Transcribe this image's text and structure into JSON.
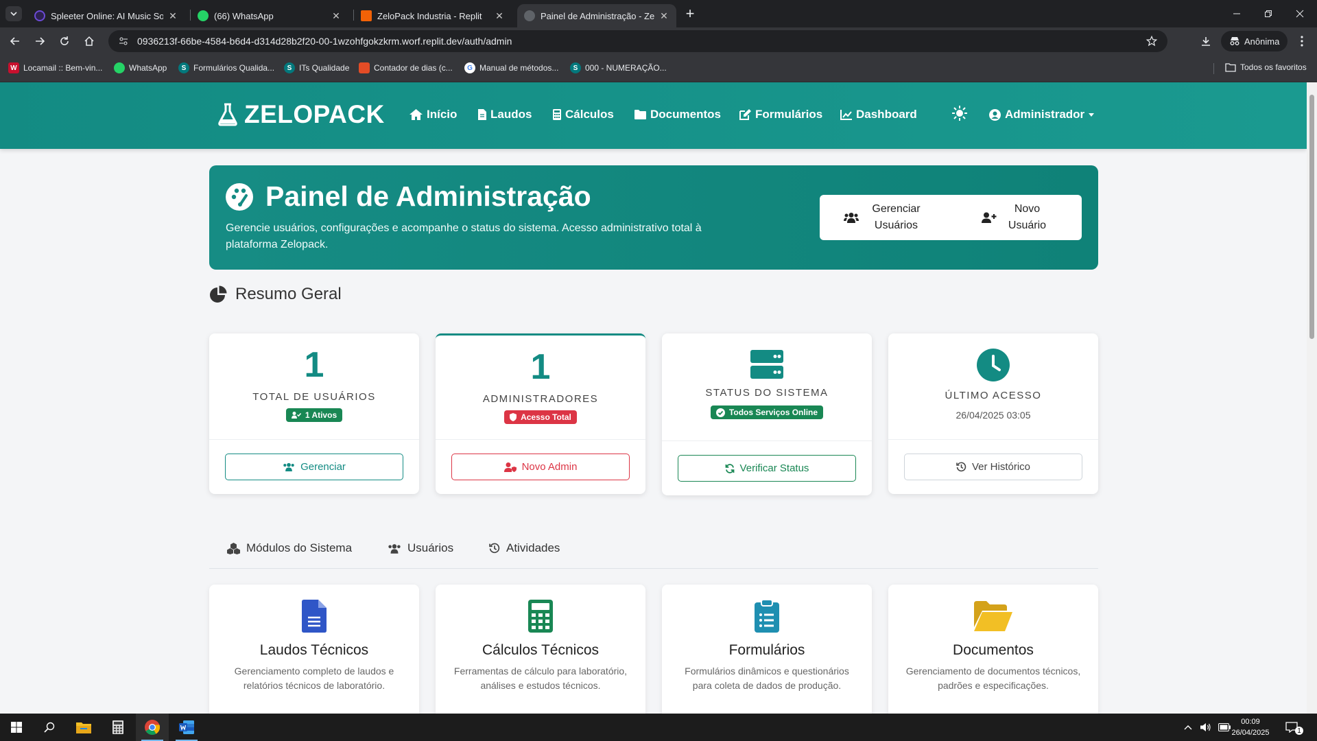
{
  "browser": {
    "tabs": [
      {
        "title": "Spleeter Online: AI Music Sourc",
        "active": false
      },
      {
        "title": "(66) WhatsApp",
        "active": false
      },
      {
        "title": "ZeloPack Industria - Replit",
        "active": false
      },
      {
        "title": "Painel de Administração - Zelop",
        "active": true
      }
    ],
    "url": "0936213f-66be-4584-b6d4-d314d28b2f20-00-1wzohfgokzkrm.worf.replit.dev/auth/admin",
    "incognito_label": "Anônima",
    "bookmarks": [
      {
        "label": "Locamail :: Bem-vin...",
        "icon": "locaweb-icon"
      },
      {
        "label": "WhatsApp",
        "icon": "whatsapp-icon"
      },
      {
        "label": "Formulários Qualida...",
        "icon": "sharepoint-icon"
      },
      {
        "label": "ITs Qualidade",
        "icon": "sharepoint-icon"
      },
      {
        "label": "Contador de dias (c...",
        "icon": "calendar-icon"
      },
      {
        "label": "Manual de métodos...",
        "icon": "google-icon"
      },
      {
        "label": "000 - NUMERAÇÃO...",
        "icon": "sharepoint-icon"
      }
    ],
    "all_bookmarks": "Todos os favoritos"
  },
  "nav": {
    "brand": "ZELOPACK",
    "links": [
      "Início",
      "Laudos",
      "Cálculos",
      "Documentos",
      "Formulários",
      "Dashboard"
    ],
    "user": "Administrador"
  },
  "hero": {
    "title": "Painel de Administração",
    "subtitle": "Gerencie usuários, configurações e acompanhe o status do sistema. Acesso administrativo total à plataforma Zelopack.",
    "btn_manage": "Gerenciar Usuários",
    "btn_new": "Novo Usuário"
  },
  "summary": {
    "title": "Resumo Geral",
    "cards": [
      {
        "value": "1",
        "label": "TOTAL DE USUÁRIOS",
        "badge": "1 Ativos",
        "button": "Gerenciar"
      },
      {
        "value": "1",
        "label": "ADMINISTRADORES",
        "badge": "Acesso Total",
        "button": "Novo Admin"
      },
      {
        "label": "STATUS DO SISTEMA",
        "badge": "Todos Serviços Online",
        "button": "Verificar Status"
      },
      {
        "label": "ÚLTIMO ACESSO",
        "date": "26/04/2025 03:05",
        "button": "Ver Histórico"
      }
    ]
  },
  "tabs": [
    "Módulos do Sistema",
    "Usuários",
    "Atividades"
  ],
  "modules": [
    {
      "title": "Laudos Técnicos",
      "desc": "Gerenciamento completo de laudos e relatórios técnicos de laboratório."
    },
    {
      "title": "Cálculos Técnicos",
      "desc": "Ferramentas de cálculo para laboratório, análises e estudos técnicos."
    },
    {
      "title": "Formulários",
      "desc": "Formulários dinâmicos e questionários para coleta de dados de produção."
    },
    {
      "title": "Documentos",
      "desc": "Gerenciamento de documentos técnicos, padrões e especificações."
    }
  ],
  "taskbar": {
    "time": "00:09",
    "date": "26/04/2025",
    "notifications": "1"
  },
  "colors": {
    "primary": "#138b83",
    "danger": "#dc3545",
    "success": "#198754"
  }
}
